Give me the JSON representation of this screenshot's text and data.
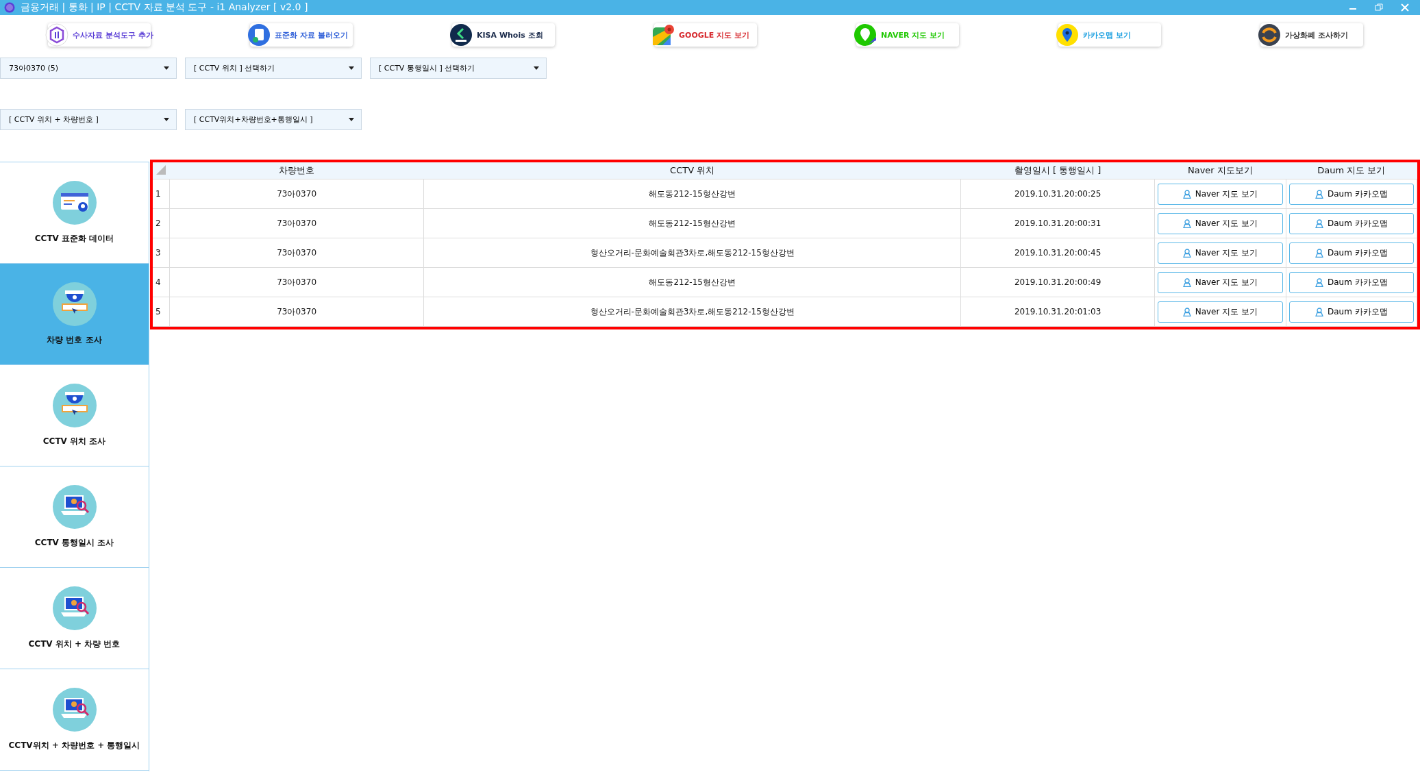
{
  "window": {
    "title": "금융거래 | 통화 | IP | CCTV 자료 분석 도구 - i1 Analyzer [ v2.0 ]"
  },
  "toolbar": [
    {
      "label": "수사자료 분석도구 추가",
      "kind": "i1",
      "color": "#5b3fd6"
    },
    {
      "label": "표준화 자료 불러오기",
      "kind": "doc",
      "color": "#2f5fd8"
    },
    {
      "label": "KISA Whois 조회",
      "kind": "kisa",
      "color": "#1a2a4a"
    },
    {
      "label": "GOOGLE 지도 보기",
      "kind": "google",
      "color": "#d6262b"
    },
    {
      "label": "NAVER 지도 보기",
      "kind": "naver",
      "color": "#1ec800"
    },
    {
      "label": "카카오맵 보기",
      "kind": "kakao",
      "color": "#1a9fe0"
    },
    {
      "label": "가상화폐 조사하기",
      "kind": "crypto",
      "color": "#333333"
    }
  ],
  "filters_row_1": [
    {
      "value": "73아0370 (5)"
    },
    {
      "value": "[ CCTV 위치 ] 선택하기"
    },
    {
      "value": "[ CCTV 통행일시 ] 선택하기"
    }
  ],
  "filters_row_2": [
    {
      "value": "[ CCTV 위치 + 차량번호 ]"
    },
    {
      "value": "[ CCTV위치+차량번호+통행일시 ]"
    }
  ],
  "sidebar": {
    "items": [
      {
        "label": "CCTV 표준화 데이터",
        "kind": "card",
        "selected": false
      },
      {
        "label": "차량 번호 조사",
        "kind": "camera",
        "selected": true
      },
      {
        "label": "CCTV 위치 조사",
        "kind": "camera",
        "selected": false
      },
      {
        "label": "CCTV 통행일시 조사",
        "kind": "laptop",
        "selected": false
      },
      {
        "label": "CCTV 위치 + 차량 번호",
        "kind": "laptop",
        "selected": false
      },
      {
        "label": "CCTV위치 + 차량번호 + 통행일시",
        "kind": "laptop",
        "selected": false
      }
    ]
  },
  "table": {
    "columns": [
      "차량번호",
      "CCTV 위치",
      "촬영일시 [ 통행일시 ]",
      "Naver 지도보기",
      "Daum 지도 보기"
    ],
    "rows": [
      {
        "number": "1",
        "plate": "73아0370",
        "location": "해도동212-15형산강변",
        "time": "2019.10.31.20:00:25",
        "naver": "Naver 지도 보기",
        "daum": "Daum 카카오맵"
      },
      {
        "number": "2",
        "plate": "73아0370",
        "location": "해도동212-15형산강변",
        "time": "2019.10.31.20:00:31",
        "naver": "Naver 지도 보기",
        "daum": "Daum 카카오맵"
      },
      {
        "number": "3",
        "plate": "73아0370",
        "location": "형산오거리-문화예술회관3차로,해도동212-15형산강변",
        "time": "2019.10.31.20:00:45",
        "naver": "Naver 지도 보기",
        "daum": "Daum 카카오맵"
      },
      {
        "number": "4",
        "plate": "73아0370",
        "location": "해도동212-15형산강변",
        "time": "2019.10.31.20:00:49",
        "naver": "Naver 지도 보기",
        "daum": "Daum 카카오맵"
      },
      {
        "number": "5",
        "plate": "73아0370",
        "location": "형산오거리-문화예술회관3차로,해도동212-15형산강변",
        "time": "2019.10.31.20:01:03",
        "naver": "Naver 지도 보기",
        "daum": "Daum 카카오맵"
      }
    ]
  }
}
